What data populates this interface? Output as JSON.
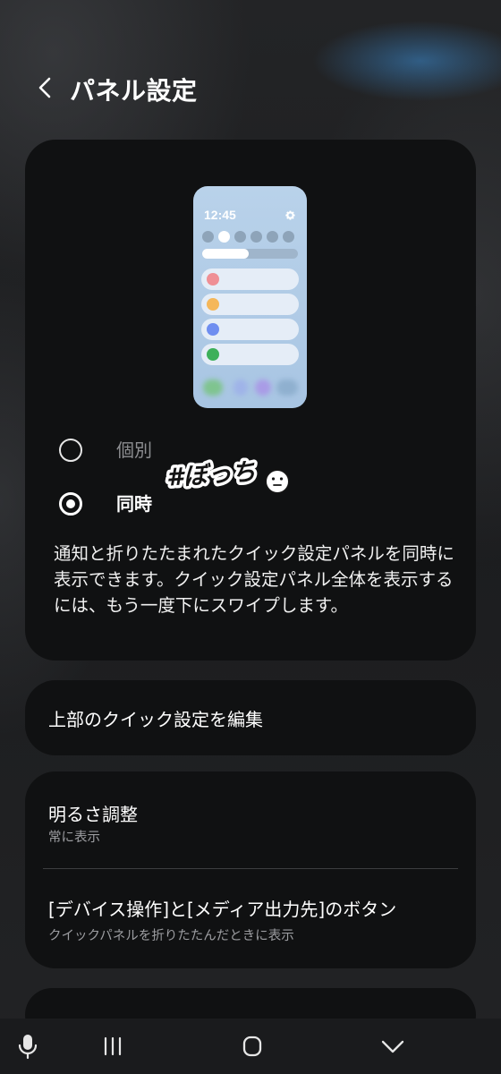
{
  "header": {
    "title": "パネル設定",
    "back_icon": "chevron-left-icon"
  },
  "preview": {
    "time": "12:45",
    "settings_icon": "gear-icon",
    "accent_colors": [
      "#ef8f95",
      "#f5b75a",
      "#6f8ef0",
      "#3db05a"
    ]
  },
  "options": [
    {
      "label": "個別",
      "selected": false
    },
    {
      "label": "同時",
      "selected": true
    }
  ],
  "sticker_text": "#ぼっち",
  "description": "通知と折りたたまれたクイック設定パネルを同時に表示できます。クイック設定パネル全体を表示するには、もう一度下にスワイプします。",
  "edit_card": {
    "label": "上部のクイック設定を編集"
  },
  "settings": [
    {
      "title": "明るさ調整",
      "subtitle": "常に表示"
    },
    {
      "title": "[デバイス操作]と[メディア出力先]のボタン",
      "subtitle": "クイックパネルを折りたたんだときに表示"
    }
  ],
  "navbar": {
    "buttons": [
      "mic-icon",
      "recent-apps-icon",
      "home-icon",
      "back-chevron-down-icon"
    ]
  }
}
